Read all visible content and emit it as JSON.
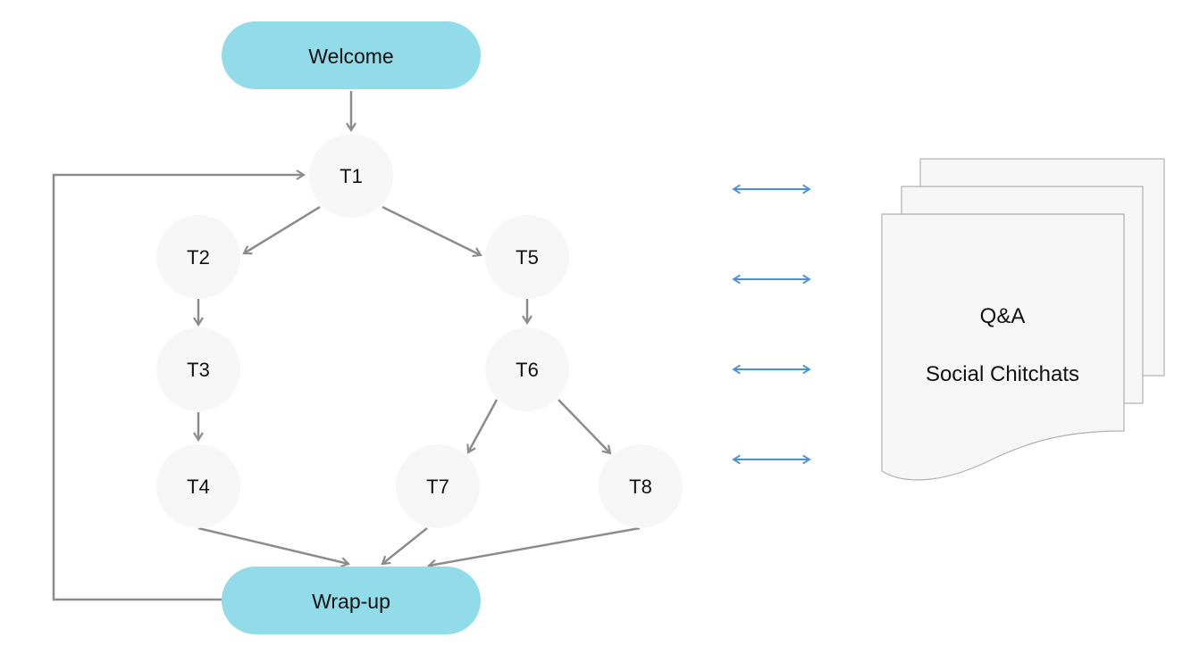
{
  "colors": {
    "terminal": "#92dbe8",
    "node": "#f7f7f7",
    "edge": "#8c8c8c",
    "link": "#4a90d9",
    "doc": "#f7f7f7",
    "doc_border": "#b0b0b0"
  },
  "terminals": {
    "start": "Welcome",
    "end": "Wrap-up"
  },
  "nodes": [
    "T1",
    "T2",
    "T3",
    "T4",
    "T5",
    "T6",
    "T7",
    "T8"
  ],
  "edges": [
    [
      "Welcome",
      "T1"
    ],
    [
      "T1",
      "T2"
    ],
    [
      "T1",
      "T5"
    ],
    [
      "T2",
      "T3"
    ],
    [
      "T3",
      "T4"
    ],
    [
      "T5",
      "T6"
    ],
    [
      "T6",
      "T7"
    ],
    [
      "T6",
      "T8"
    ],
    [
      "T4",
      "Wrap-up"
    ],
    [
      "T7",
      "Wrap-up"
    ],
    [
      "T8",
      "Wrap-up"
    ],
    [
      "Wrap-up",
      "T1"
    ]
  ],
  "bidirectional_link_count": 4,
  "document": {
    "line1": "Q&A",
    "line2": "Social Chitchats"
  }
}
